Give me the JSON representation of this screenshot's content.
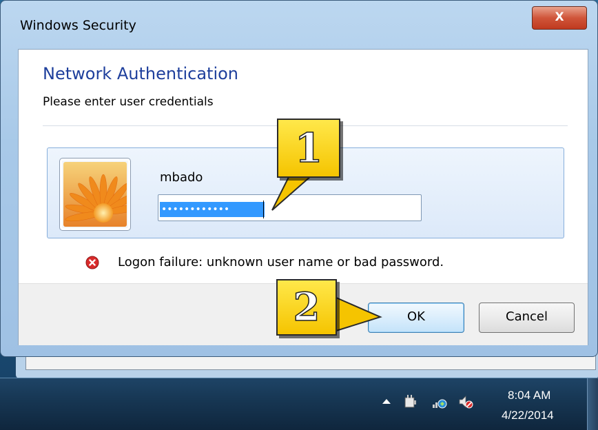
{
  "dialog": {
    "title": "Windows Security",
    "close_label": "X",
    "heading": "Network Authentication",
    "subheading": "Please enter user credentials",
    "username": "mbado",
    "password_masked": "••••••••••••",
    "error_message": "Logon failure: unknown user name or bad password.",
    "ok_label": "OK",
    "cancel_label": "Cancel"
  },
  "callouts": [
    {
      "label": "1"
    },
    {
      "label": "2"
    }
  ],
  "taskbar": {
    "time": "8:04 AM",
    "date": "4/22/2014",
    "tray_icons": [
      "show-hidden-icons",
      "power-plug-icon",
      "network-icon",
      "volume-muted-icon"
    ]
  },
  "colors": {
    "heading": "#1e3f9c",
    "selection": "#3399ff",
    "callout_fill": "#f5c400",
    "close_button": "#c03a1f"
  }
}
